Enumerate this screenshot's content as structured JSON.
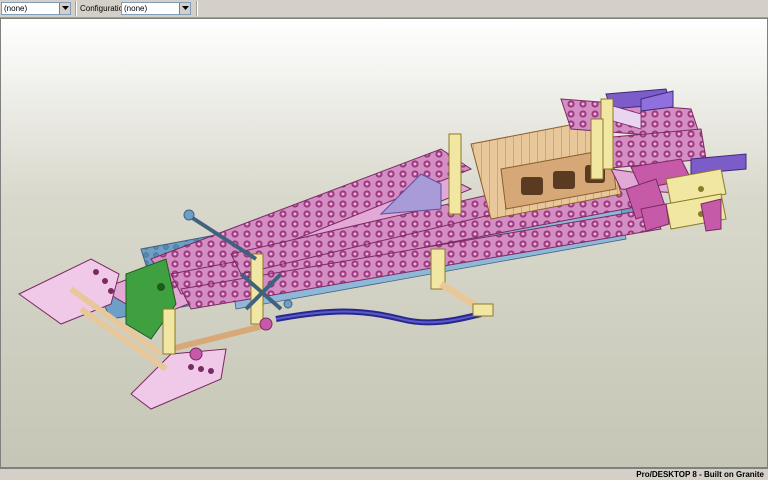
{
  "toolbar": {
    "selector_value": "(none)",
    "configuration_label": "Configuration:",
    "configuration_value": "(none)"
  },
  "status": {
    "text": "Pro/DESKTOP 8 - Built on Granite"
  },
  "colors": {
    "pink_bricks": "#d58ec4",
    "blue_plates": "#6e9fc6",
    "tan_parts": "#e8c79a",
    "green_parts": "#3fa03f",
    "navy_cable": "#28288c",
    "viewport_bg_top": "#ffffff",
    "viewport_bg_bottom": "#c6c6b6"
  }
}
